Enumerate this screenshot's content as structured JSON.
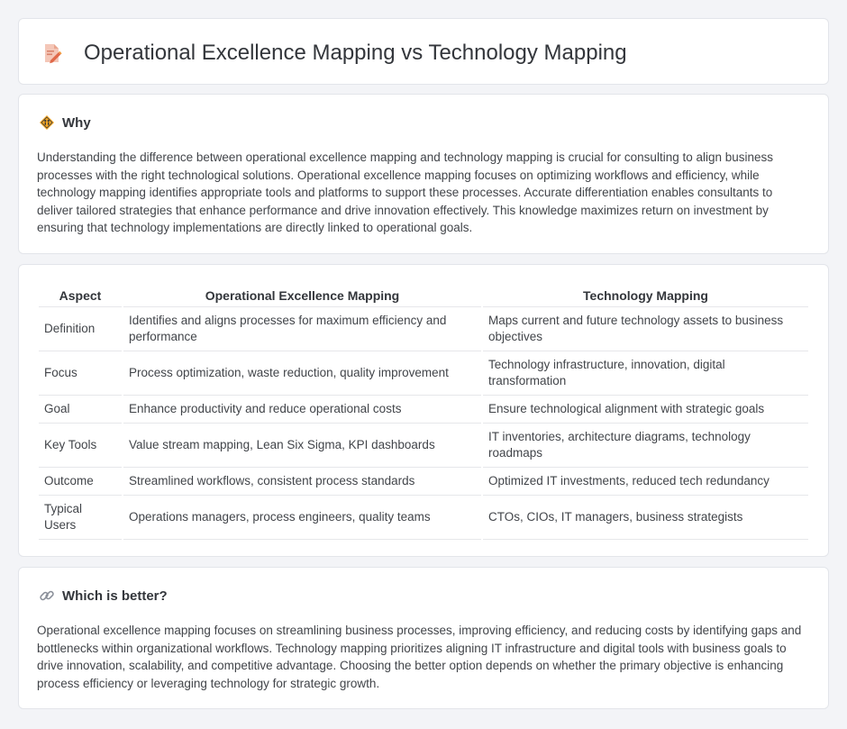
{
  "title": "Operational Excellence Mapping vs Technology Mapping",
  "icons": {
    "title": "document-edit-icon",
    "why": "diamond-sign-icon",
    "better": "link-icon"
  },
  "why": {
    "heading": "Why",
    "text": "Understanding the difference between operational excellence mapping and technology mapping is crucial for consulting to align business processes with the right technological solutions. Operational excellence mapping focuses on optimizing workflows and efficiency, while technology mapping identifies appropriate tools and platforms to support these processes. Accurate differentiation enables consultants to deliver tailored strategies that enhance performance and drive innovation effectively. This knowledge maximizes return on investment by ensuring that technology implementations are directly linked to operational goals."
  },
  "table": {
    "headers": [
      "Aspect",
      "Operational Excellence Mapping",
      "Technology Mapping"
    ],
    "rows": [
      [
        "Definition",
        "Identifies and aligns processes for maximum efficiency and performance",
        "Maps current and future technology assets to business objectives"
      ],
      [
        "Focus",
        "Process optimization, waste reduction, quality improvement",
        "Technology infrastructure, innovation, digital transformation"
      ],
      [
        "Goal",
        "Enhance productivity and reduce operational costs",
        "Ensure technological alignment with strategic goals"
      ],
      [
        "Key Tools",
        "Value stream mapping, Lean Six Sigma, KPI dashboards",
        "IT inventories, architecture diagrams, technology roadmaps"
      ],
      [
        "Outcome",
        "Streamlined workflows, consistent process standards",
        "Optimized IT investments, reduced tech redundancy"
      ],
      [
        "Typical Users",
        "Operations managers, process engineers, quality teams",
        "CTOs, CIOs, IT managers, business strategists"
      ]
    ]
  },
  "better": {
    "heading": "Which is better?",
    "text": "Operational excellence mapping focuses on streamlining business processes, improving efficiency, and reducing costs by identifying gaps and bottlenecks within organizational workflows. Technology mapping prioritizes aligning IT infrastructure and digital tools with business goals to drive innovation, scalability, and competitive advantage. Choosing the better option depends on whether the primary objective is enhancing process efficiency or leveraging technology for strategic growth."
  }
}
